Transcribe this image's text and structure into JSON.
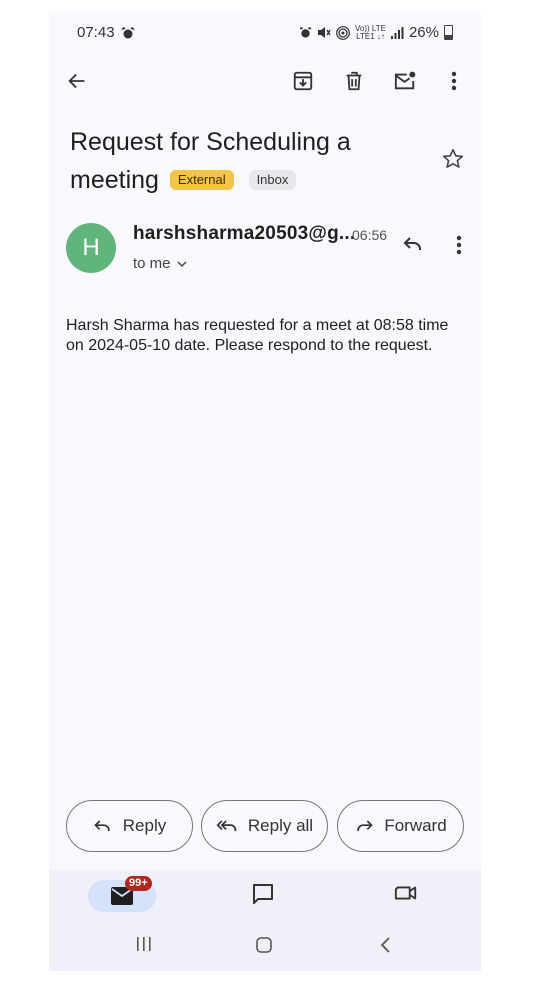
{
  "status_bar": {
    "time": "07:43",
    "lte_top": "Vo)) LTE",
    "lte_bottom": "LTE1 ↓↑",
    "battery": "26%"
  },
  "toolbar": {
    "back_icon": "arrow-left-icon",
    "archive_icon": "archive-icon",
    "delete_icon": "trash-icon",
    "mark_unread_icon": "mail-unread-icon",
    "more_icon": "more-vert-icon"
  },
  "email": {
    "subject": "Request for Scheduling a meeting",
    "labels": [
      "External",
      "Inbox"
    ],
    "sender_initial": "H",
    "sender": "harshsharma20503@g...",
    "time": "06:56",
    "recipient": "to me",
    "body": "Harsh Sharma has requested for a meet at 08:58 time on 2024-05-10 date. Please respond to the request."
  },
  "actions": {
    "reply": "Reply",
    "reply_all": "Reply all",
    "forward": "Forward"
  },
  "bottom_nav": {
    "mail_badge": "99+"
  },
  "colors": {
    "avatar": "#5fb57a",
    "external_label": "#f6c445",
    "badge": "#b3261e",
    "nav_active": "#d5e2fb"
  }
}
